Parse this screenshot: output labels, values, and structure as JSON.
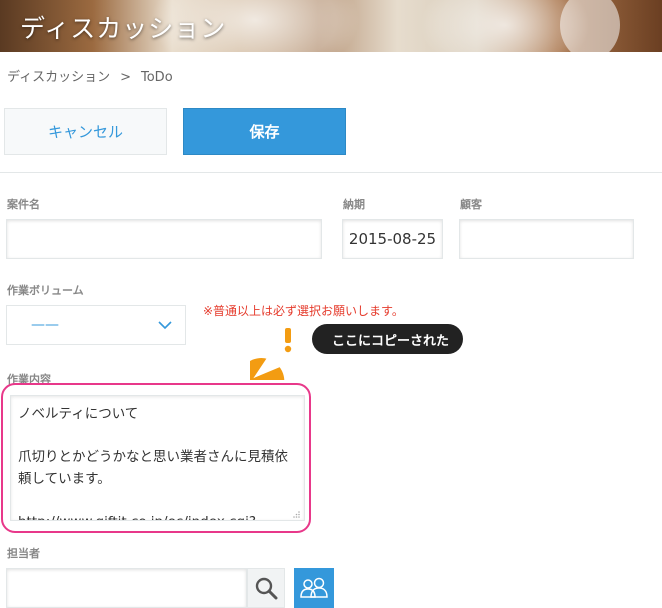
{
  "header": {
    "title": "ディスカッション"
  },
  "breadcrumb": {
    "items": [
      "ディスカッション",
      "ToDo"
    ],
    "separator": ">"
  },
  "toolbar": {
    "cancel_label": "キャンセル",
    "save_label": "保存"
  },
  "form": {
    "project_name": {
      "label": "案件名",
      "value": ""
    },
    "due_date": {
      "label": "納期",
      "value": "2015-08-25"
    },
    "customer": {
      "label": "顧客",
      "value": ""
    },
    "work_volume": {
      "label": "作業ボリューム",
      "selected": "——",
      "warning": "※普通以上は必ず選択お願いします。"
    },
    "work_content": {
      "label": "作業内容",
      "value": "ノベルティについて\n\n爪切りとかどうかなと思い業者さんに見積依頼しています。\n\nhttp://www.giftit.co.jp/ec/index.cgi?"
    },
    "assignee": {
      "label": "担当者",
      "value": ""
    }
  },
  "annotation": {
    "callout": "ここにコピーされた"
  },
  "colors": {
    "accent": "#3498db",
    "warning": "#e53b2c",
    "highlight": "#e8388a",
    "callout_bg": "#222222",
    "alert_icon": "#f39c12"
  },
  "icons": {
    "select": "chevron-down-icon",
    "search": "search-icon",
    "users": "users-icon",
    "alert": "exclamation-icon"
  }
}
